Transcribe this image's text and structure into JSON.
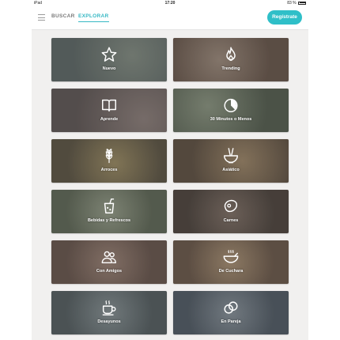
{
  "status_bar": {
    "carrier": "iPad",
    "time": "17:20",
    "battery": "83 %"
  },
  "nav": {
    "tabs": [
      {
        "label": "BUSCAR"
      },
      {
        "label": "EXPLORAR",
        "active": true
      }
    ],
    "register_label": "Regístrate"
  },
  "colors": {
    "accent": "#2fbfc8",
    "nav_bg": "#ffffff",
    "page_bg": "#f1f0ef"
  },
  "categories": [
    {
      "label": "Nuevo",
      "icon": "star-icon",
      "bg": "#6f7a78"
    },
    {
      "label": "Trending",
      "icon": "flame-icon",
      "bg": "#8a6e5c"
    },
    {
      "label": "Aprende",
      "icon": "book-icon",
      "bg": "#7c6d6a"
    },
    {
      "label": "30 Minutos o Menos",
      "icon": "timer-icon",
      "bg": "#6e7a62"
    },
    {
      "label": "Arroces",
      "icon": "wheat-icon",
      "bg": "#7a6e4e"
    },
    {
      "label": "Asiático",
      "icon": "bowl-chopsticks-icon",
      "bg": "#7f6a52"
    },
    {
      "label": "Bebidas y Refrescos",
      "icon": "drink-icon",
      "bg": "#7e8a72"
    },
    {
      "label": "Carnes",
      "icon": "meat-icon",
      "bg": "#66564c"
    },
    {
      "label": "Con Amigos",
      "icon": "friends-icon",
      "bg": "#8a6e60"
    },
    {
      "label": "De Cuchara",
      "icon": "soup-icon",
      "bg": "#8f7456"
    },
    {
      "label": "Desayunos",
      "icon": "breakfast-icon",
      "bg": "#6e7d82"
    },
    {
      "label": "En Pareja",
      "icon": "rings-icon",
      "bg": "#6c7a86"
    }
  ]
}
